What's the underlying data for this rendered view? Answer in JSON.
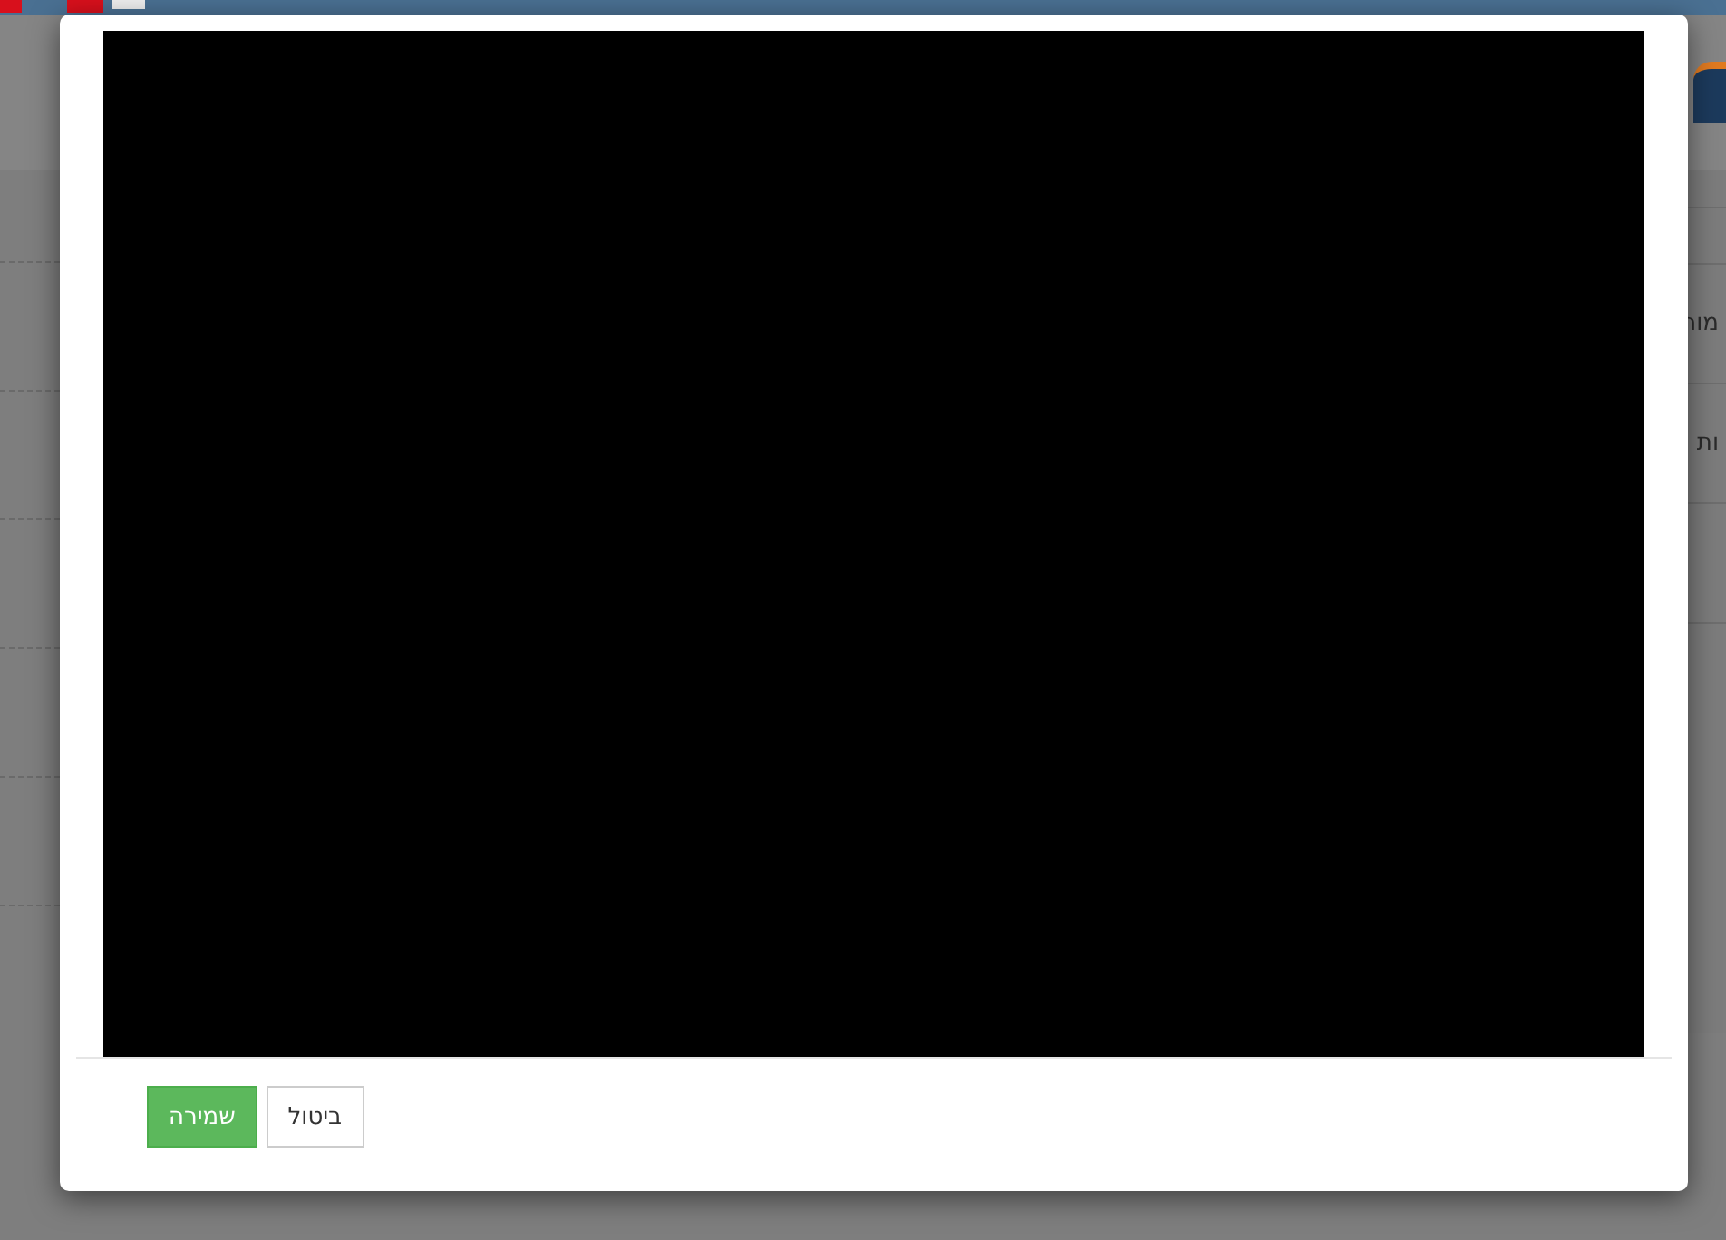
{
  "side_menu": {
    "items": [
      "מור",
      "ות"
    ]
  },
  "modal": {
    "buttons": [
      {
        "label": "ביטול",
        "kind": "default"
      },
      {
        "label": "שמירה",
        "kind": "primary"
      }
    ]
  }
}
